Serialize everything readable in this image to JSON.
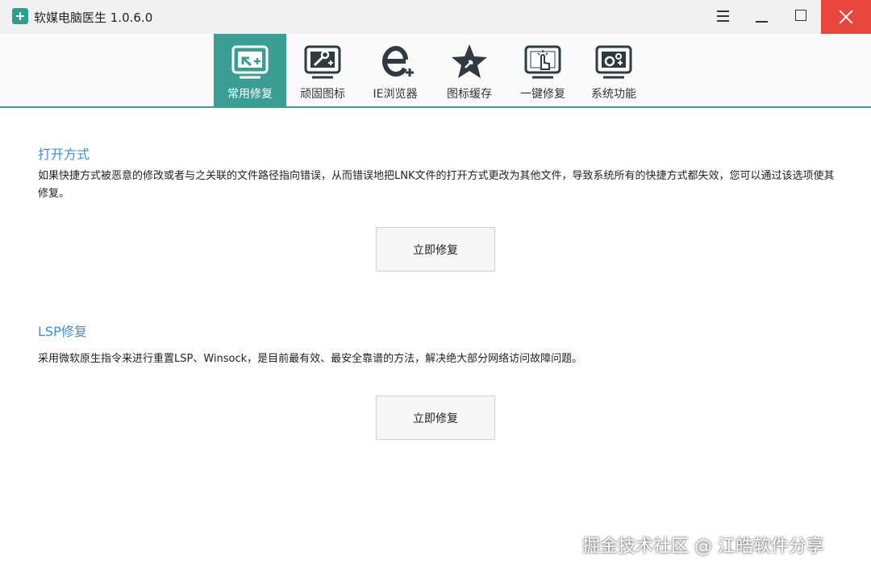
{
  "window": {
    "title": "软媒电脑医生 1.0.6.0"
  },
  "tabs": [
    {
      "label": "常用修复",
      "icon": "shortcut-repair-icon",
      "active": true
    },
    {
      "label": "顽固图标",
      "icon": "wrench-icon",
      "active": false
    },
    {
      "label": "IE浏览器",
      "icon": "ie-plus-icon",
      "active": false
    },
    {
      "label": "图标缓存",
      "icon": "star-cache-icon",
      "active": false
    },
    {
      "label": "一键修复",
      "icon": "hand-click-icon",
      "active": false
    },
    {
      "label": "系统功能",
      "icon": "gears-icon",
      "active": false
    }
  ],
  "sections": [
    {
      "title": "打开方式",
      "description": "如果快捷方式被恶意的修改或者与之关联的文件路径指向错误，从而错误地把LNK文件的打开方式更改为其他文件，导致系统所有的快捷方式都失效，您可以通过该选项使其修复。",
      "button": "立即修复"
    },
    {
      "title": "LSP修复",
      "description": "采用微软原生指令来进行重置LSP、Winsock，是目前最有效、最安全靠谱的方法，解决绝大部分网络访问故障问题。",
      "button": "立即修复"
    }
  ],
  "watermark": "掘金技术社区 @ 江皓软件分享",
  "colors": {
    "accent": "#3a9e94",
    "title_blue": "#3b8fd8",
    "close_red": "#e8453c",
    "icon_dark": "#2f3b40"
  }
}
